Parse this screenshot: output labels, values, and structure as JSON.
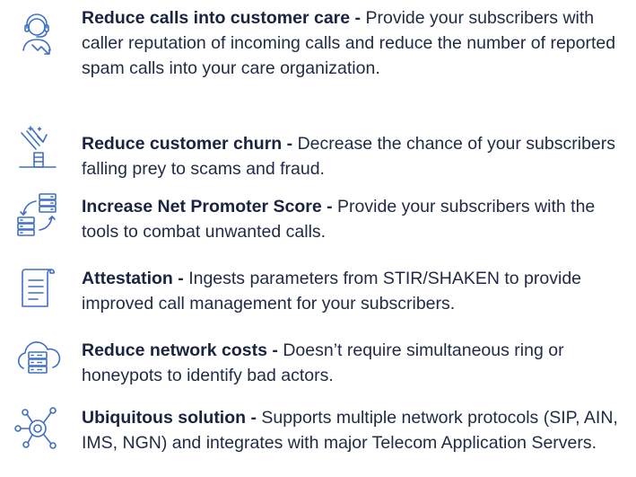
{
  "accent_color": "#3f6fc7",
  "items": [
    {
      "icon": "headset-agent-icon",
      "title": "Reduce calls into customer care",
      "separator": " - ",
      "description": "Provide your subscribers with caller reputation of incoming calls and reduce the number of reported spam calls into your care organization."
    },
    {
      "icon": "churn-decrease-icon",
      "title": "Reduce customer churn",
      "separator": " - ",
      "description": "Decrease the chance of your subscribers falling prey to scams and fraud."
    },
    {
      "icon": "server-sync-icon",
      "title": "Increase Net Promoter Score",
      "separator": " - ",
      "description": "Provide your subscribers with the tools to combat unwanted calls."
    },
    {
      "icon": "document-scroll-icon",
      "title": "Attestation",
      "separator": " - ",
      "description": "Ingests parameters from STIR/SHAKEN to provide improved call management for your subscribers."
    },
    {
      "icon": "cloud-server-icon",
      "title": "Reduce network costs",
      "separator": " - ",
      "description": "Doesn’t require simultaneous ring or honeypots to identify bad actors."
    },
    {
      "icon": "network-hub-icon",
      "title": "Ubiquitous solution",
      "separator": " - ",
      "description": "Supports multiple network protocols (SIP, AIN, IMS, NGN) and integrates with major Telecom Application Servers."
    }
  ]
}
